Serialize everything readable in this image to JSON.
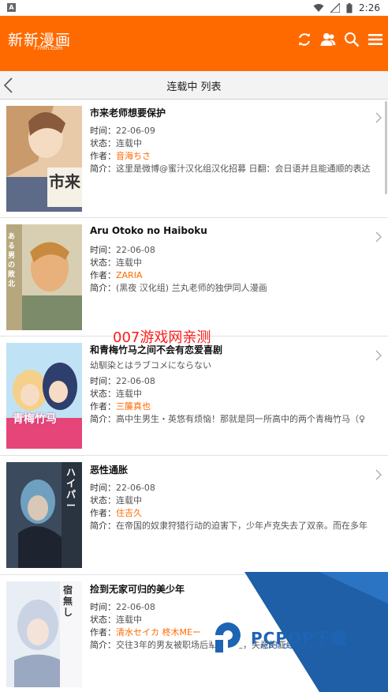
{
  "status_bar": {
    "time": "2:26",
    "notification_icon": "A"
  },
  "app_bar": {
    "logo": "新新漫画",
    "logo_sub": "77mh.com",
    "icons": [
      "refresh-icon",
      "user-icon",
      "search-icon",
      "menu-icon"
    ]
  },
  "sub_bar": {
    "title": "连载中 列表"
  },
  "labels": {
    "time": "时间：",
    "status": "状态：",
    "author": "作者：",
    "intro": "简介："
  },
  "items": [
    {
      "title": "市来老师想要保护",
      "subtitle": "",
      "time": "22-06-09",
      "status": "连载中",
      "author": "音海ちさ",
      "intro": "这里是微博@蜜汁汉化组汉化招募 日翻：会日语并且能通顺的表达",
      "cover_text": "市来"
    },
    {
      "title": "Aru Otoko no Haiboku",
      "subtitle": "",
      "time": "22-06-08",
      "status": "连载中",
      "author": "ZARIA",
      "intro": "(黑夜 汉化组) 兰丸老师的独伊同人漫画",
      "cover_text": "ある男の敗北"
    },
    {
      "title": "和青梅竹马之间不会有恋爱喜剧",
      "subtitle": "幼馴染とはラブコメにならない",
      "time": "22-06-08",
      "status": "连载中",
      "author": "三簾真也",
      "intro": "高中生男生・英悠有烦恼！那就是同一所高中的两个青梅竹马（♀",
      "cover_text": "青梅竹马"
    },
    {
      "title": "恶性通胀",
      "subtitle": "",
      "time": "22-06-08",
      "status": "连载中",
      "author": "住吉久",
      "intro": "在帝国的奴隶狩猎行动的迫害下，少年卢克失去了双亲。而在多年",
      "cover_text": "ハイパー"
    },
    {
      "title": "捡到无家可归的美少年",
      "subtitle": "",
      "time": "22-06-08",
      "status": "连载中",
      "author": "清水セイカ 柊木MEー",
      "intro": "交往3年的男友被职场后辈给抢走，失意的亚绪",
      "cover_text": "宿無し"
    }
  ],
  "overlays": {
    "watermark": "007游戏网亲测",
    "pcpop_logo": "PCPOP下载",
    "pcpop_sub": "PCPOP Download"
  },
  "colors": {
    "accent": "#ff6a00",
    "watermark": "#ff1a1a",
    "pcpop": "#1e64b4"
  }
}
